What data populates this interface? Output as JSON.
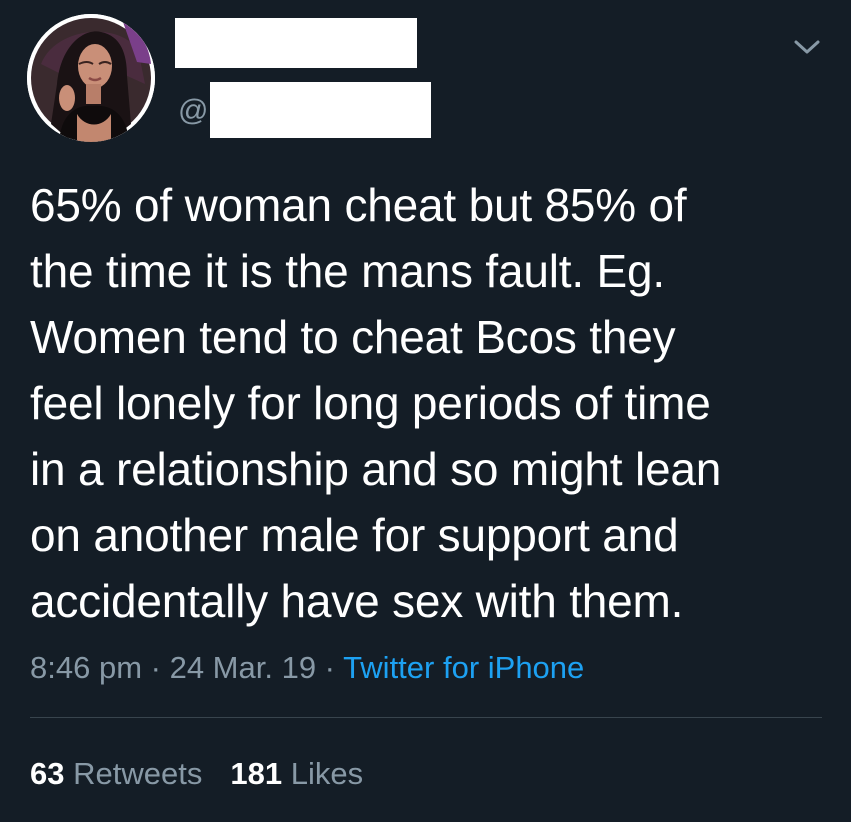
{
  "author": {
    "at_symbol": "@",
    "avatar_icon": "profile-photo"
  },
  "tweet": {
    "text": "65% of woman cheat but 85% of\nthe time it is the mans fault. Eg.\nWomen tend to cheat Bcos they\nfeel lonely for long periods of time\nin a relationship and so might lean\non another male for support and\naccidentally have sex with them.",
    "time": "8:46 pm",
    "separator": " · ",
    "date": "24 Mar. 19",
    "source": "Twitter for iPhone"
  },
  "stats": {
    "retweets_count": "63",
    "retweets_label": "Retweets",
    "likes_count": "181",
    "likes_label": "Likes"
  },
  "menu_icon": "chevron-down-icon",
  "colors": {
    "background": "#141d26",
    "text": "#ffffff",
    "secondary_text": "#8899a6",
    "link": "#1da1f2",
    "divider": "#38444d"
  }
}
